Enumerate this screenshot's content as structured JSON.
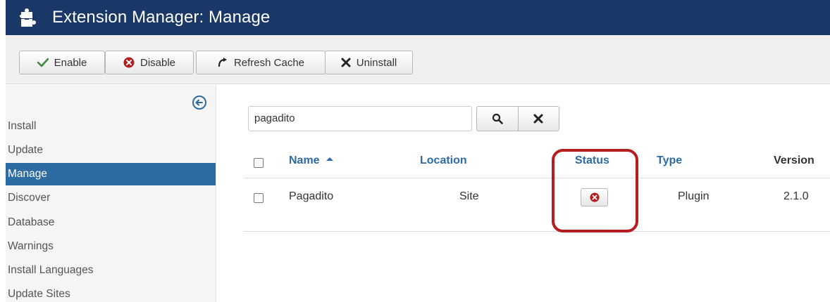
{
  "header": {
    "title": "Extension Manager: Manage",
    "icon": "puzzle-piece-icon",
    "bg_color": "#1a3867"
  },
  "toolbar": {
    "enable_label": "Enable",
    "disable_label": "Disable",
    "refresh_label": "Refresh Cache",
    "uninstall_label": "Uninstall"
  },
  "sidebar": {
    "items": [
      {
        "label": "Install",
        "active": false
      },
      {
        "label": "Update",
        "active": false
      },
      {
        "label": "Manage",
        "active": true
      },
      {
        "label": "Discover",
        "active": false
      },
      {
        "label": "Database",
        "active": false
      },
      {
        "label": "Warnings",
        "active": false
      },
      {
        "label": "Install Languages",
        "active": false
      },
      {
        "label": "Update Sites",
        "active": false
      }
    ]
  },
  "search": {
    "value": "pagadito"
  },
  "table": {
    "columns": {
      "name": "Name",
      "location": "Location",
      "status": "Status",
      "type": "Type",
      "version": "Version"
    },
    "rows": [
      {
        "name": "Pagadito",
        "location": "Site",
        "status": "disabled",
        "type": "Plugin",
        "version": "2.1.0"
      }
    ]
  },
  "colors": {
    "accent": "#2d6ca2",
    "success": "#3c8b3c",
    "danger": "#b41e1e",
    "highlight": "#b41e1e"
  }
}
